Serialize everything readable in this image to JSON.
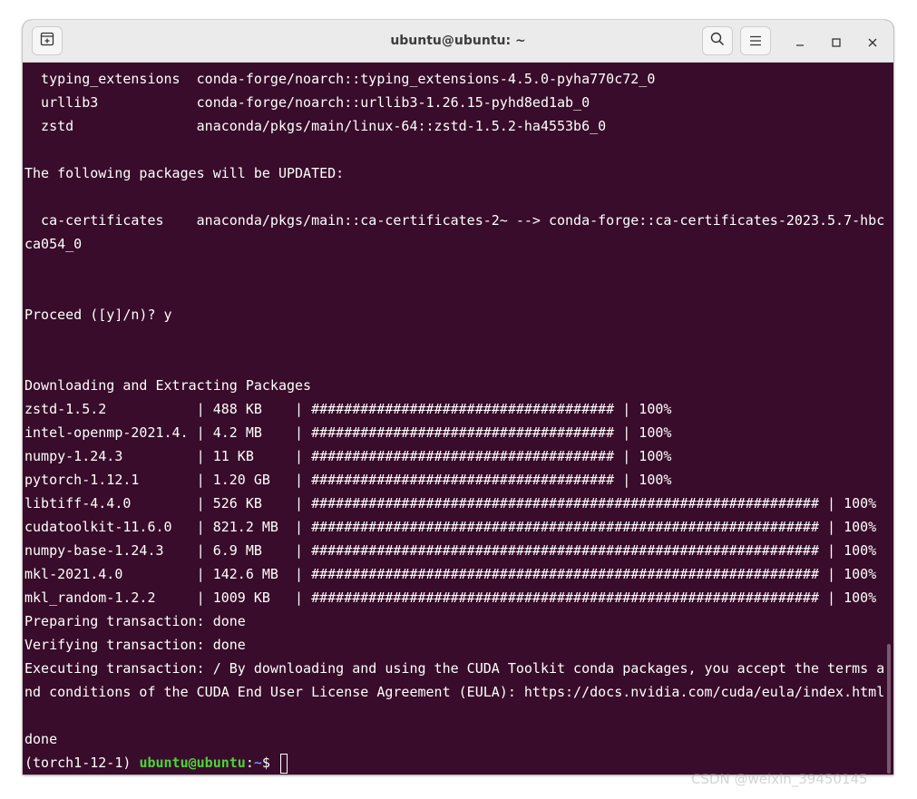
{
  "window": {
    "title": "ubuntu@ubuntu: ~"
  },
  "titlebar": {
    "new_tab_icon": "new-tab-icon",
    "search_icon": "search-icon",
    "menu_icon": "hamburger-menu-icon",
    "minimize_icon": "minimize-icon",
    "maximize_icon": "maximize-icon",
    "close_icon": "close-icon"
  },
  "terminal": {
    "colors": {
      "background": "#380c2a",
      "prompt_user": "#4bd43a",
      "prompt_path": "#6f8ff3"
    },
    "lines": [
      "  typing_extensions  conda-forge/noarch::typing_extensions-4.5.0-pyha770c72_0",
      "  urllib3            conda-forge/noarch::urllib3-1.26.15-pyhd8ed1ab_0",
      "  zstd               anaconda/pkgs/main/linux-64::zstd-1.5.2-ha4553b6_0",
      "",
      "The following packages will be UPDATED:",
      "",
      "  ca-certificates    anaconda/pkgs/main::ca-certificates-2~ --> conda-forge::ca-certificates-2023.5.7-hbc",
      "ca054_0",
      "",
      "",
      "Proceed ([y]/n)? y",
      "",
      "",
      "Downloading and Extracting Packages",
      "zstd-1.5.2           | 488 KB    | ##################################### | 100%",
      "intel-openmp-2021.4. | 4.2 MB    | ##################################### | 100%",
      "numpy-1.24.3         | 11 KB     | ##################################### | 100%",
      "pytorch-1.12.1       | 1.20 GB   | ##################################### | 100%",
      "libtiff-4.4.0        | 526 KB    | ############################################################## | 100%",
      "cudatoolkit-11.6.0   | 821.2 MB  | ############################################################## | 100%",
      "numpy-base-1.24.3    | 6.9 MB    | ############################################################## | 100%",
      "mkl-2021.4.0         | 142.6 MB  | ############################################################## | 100%",
      "mkl_random-1.2.2     | 1009 KB   | ############################################################## | 100%",
      "Preparing transaction: done",
      "Verifying transaction: done",
      "Executing transaction: / By downloading and using the CUDA Toolkit conda packages, you accept the terms a",
      "nd conditions of the CUDA End User License Agreement (EULA): https://docs.nvidia.com/cuda/eula/index.html",
      "",
      "done"
    ],
    "prompt": {
      "env": "(torch1-12-1) ",
      "user_host": "ubuntu@ubuntu",
      "sep": ":",
      "path": "~",
      "symbol": "$ "
    }
  },
  "watermark": "CSDN @weixin_39450145"
}
